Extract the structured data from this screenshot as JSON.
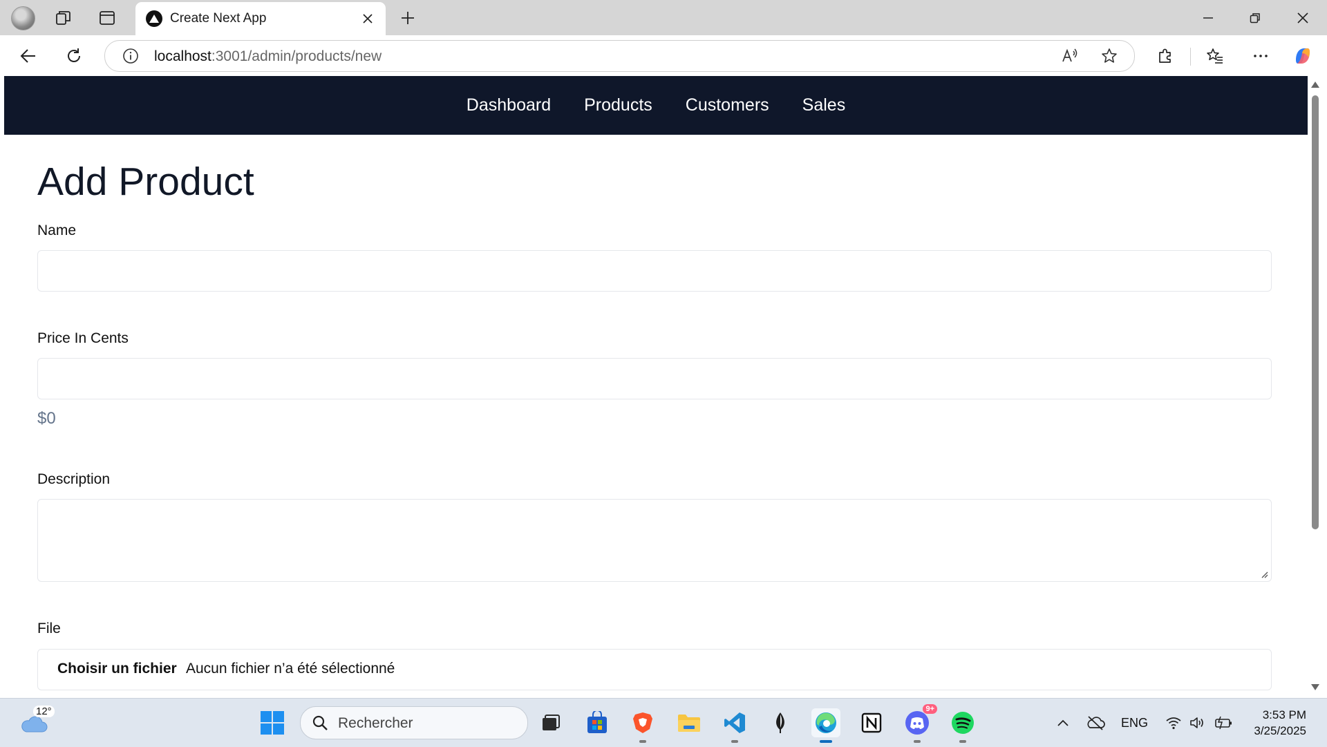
{
  "browser": {
    "tab_title": "Create Next App",
    "url_host": "localhost",
    "url_path": ":3001/admin/products/new"
  },
  "site_nav": {
    "links": [
      "Dashboard",
      "Products",
      "Customers",
      "Sales"
    ]
  },
  "form": {
    "title": "Add Product",
    "name_label": "Name",
    "name_value": "",
    "price_label": "Price In Cents",
    "price_value": "",
    "price_preview": "$0",
    "description_label": "Description",
    "description_value": "",
    "file_label": "File",
    "file_button": "Choisir un fichier",
    "file_status": "Aucun fichier n’a été sélectionné"
  },
  "taskbar": {
    "weather_temp": "12°",
    "search_placeholder": "Rechercher",
    "discord_badge": "9+",
    "language": "ENG",
    "time": "3:53 PM",
    "date": "3/25/2025"
  },
  "colors": {
    "nav_background": "#0f172a",
    "price_preview": "#64748b",
    "input_border": "#e5e7eb"
  }
}
